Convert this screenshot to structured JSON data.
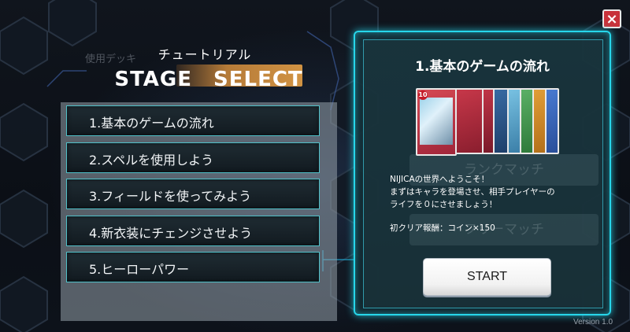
{
  "header": {
    "subtitle": "チュートリアル",
    "title": "STAGE　SELECT",
    "ghost_deck_label": "使用デッキ"
  },
  "stages": [
    {
      "label": "1.基本のゲームの流れ"
    },
    {
      "label": "2.スペルを使用しよう"
    },
    {
      "label": "3.フィールドを使ってみよう"
    },
    {
      "label": "4.新衣装にチェンジさせよう"
    },
    {
      "label": "5.ヒーローパワー"
    }
  ],
  "detail": {
    "title": "1.基本のゲームの流れ",
    "description_line1": "NIJICAの世界へようこそ！",
    "description_line2": "まずはキャラを登場させ、相手プレイヤーの",
    "description_line3": "ライフを０にさせましょう！",
    "reward": "初クリア報酬：コイン×150",
    "start_label": "START",
    "front_card_cost": "10",
    "ghost_buttons": [
      "ランクマッチ",
      "フリーマッチ"
    ]
  },
  "close_label": "×",
  "version": "Version 1.0",
  "colors": {
    "accent_cyan": "#27d6ea",
    "close_red": "#c8323a",
    "title_plate": "#d28c3c"
  }
}
